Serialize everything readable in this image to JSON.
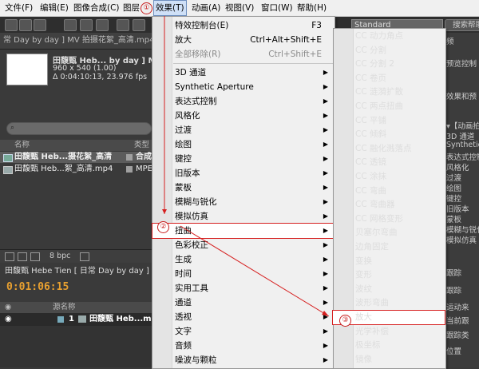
{
  "menubar": {
    "items": [
      "文件(F)",
      "编辑(E)",
      "图像合成(C)",
      "图层",
      "效果(T)",
      "动画(A)",
      "视图(V)",
      "窗口(W)",
      "帮助(H)"
    ],
    "markers": [
      "①",
      "②",
      "③"
    ]
  },
  "toolbar": {
    "workspace_value": "Standard",
    "search_placeholder": "搜索帮助"
  },
  "project": {
    "tab": "常 Day by day ] MV 拍摄花絮_高清.mp4",
    "title": "田馥甄 Heb... by day ] MV ▾",
    "dims": "960 x 540 (1.00)",
    "duration": "Δ 0:04:10:13, 23.976 fps",
    "col_name": "名称",
    "col_type": "类型",
    "rows": [
      {
        "name": "田馥甄 Heb...摄花絮_高清",
        "type": "合成"
      },
      {
        "name": "田馥甄 Heb...絮_高清.mp4",
        "type": "MPE"
      }
    ],
    "bpc": "8 bpc"
  },
  "timeline": {
    "tab": "田馥甄 Hebe Tien [ 日常 Day by day ] MV 拍",
    "time": "0:01:06:15",
    "col_name": "源名称",
    "row_index": "1",
    "row_name": "田馥甄 Heb...mp"
  },
  "right_panel": {
    "labels": [
      "频",
      "预览控制",
      "效果和预",
      "▾【动画拍",
      "3D 通道",
      "Synthetic A",
      "表达式控制",
      "风格化",
      "过渡",
      "绘图",
      "键控",
      "旧版本",
      "蒙板",
      "模糊与锐化",
      "模拟仿真",
      "跟踪",
      "跟踪",
      "运动来",
      "当前跟",
      "跟踪类",
      "位置"
    ]
  },
  "effect_menu": {
    "items": [
      {
        "label": "特效控制台(E)",
        "shortcut": "F3"
      },
      {
        "label": "放大",
        "shortcut": "Ctrl+Alt+Shift+E"
      },
      {
        "label": "全部移除(R)",
        "shortcut": "Ctrl+Shift+E"
      },
      {
        "label": "3D 通道"
      },
      {
        "label": "Synthetic Aperture"
      },
      {
        "label": "表达式控制"
      },
      {
        "label": "风格化"
      },
      {
        "label": "过渡"
      },
      {
        "label": "绘图"
      },
      {
        "label": "键控"
      },
      {
        "label": "旧版本"
      },
      {
        "label": "蒙板"
      },
      {
        "label": "模糊与锐化"
      },
      {
        "label": "模拟仿真"
      },
      {
        "label": "扭曲"
      },
      {
        "label": "色彩校正"
      },
      {
        "label": "生成"
      },
      {
        "label": "时间"
      },
      {
        "label": "实用工具"
      },
      {
        "label": "通道"
      },
      {
        "label": "透视"
      },
      {
        "label": "文字"
      },
      {
        "label": "音频"
      },
      {
        "label": "噪波与颗粒"
      }
    ]
  },
  "distort_menu": {
    "items": [
      "CC 动力角点",
      "CC 分割",
      "CC 分割 2",
      "CC 卷页",
      "CC 涟漪扩散",
      "CC 两点扭曲",
      "CC 平铺",
      "CC 倾斜",
      "CC 融化溅落点",
      "CC 透镜",
      "CC 涂抹",
      "CC 弯曲",
      "CC 弯曲器",
      "CC 网格变形",
      "贝塞尔弯曲",
      "边角固定",
      "变换",
      "变形",
      "波纹",
      "波形弯曲",
      "放大",
      "光学补偿",
      "极坐标",
      "镜像"
    ]
  },
  "colors": {
    "highlight": "#d62020",
    "menu_bg": "#f0f0f0",
    "app_bg": "#3a3a3a",
    "time": "#e8a030"
  }
}
